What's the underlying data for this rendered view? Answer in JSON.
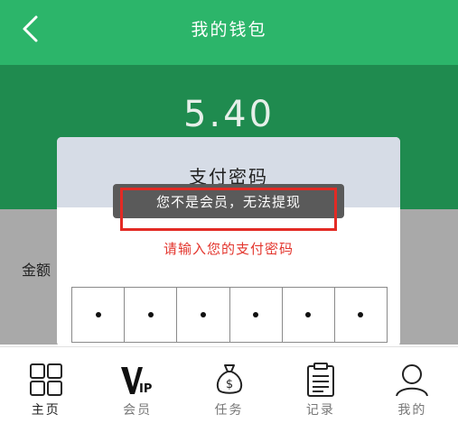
{
  "header": {
    "title": "我的钱包",
    "back_icon": "chevron-left-icon"
  },
  "wallet": {
    "balance": "5.40",
    "amount_label": "金额"
  },
  "dialog": {
    "title": "支付密码",
    "hint": "请输入您的支付密码",
    "pin_length": 6,
    "pin_filled": 6
  },
  "toast": {
    "message": "您不是会员，无法提现"
  },
  "tabbar": {
    "items": [
      {
        "label": "主页",
        "icon": "grid-home-icon",
        "active": true
      },
      {
        "label": "会员",
        "icon": "vip-icon",
        "active": false
      },
      {
        "label": "任务",
        "icon": "money-bag-icon",
        "active": false
      },
      {
        "label": "记录",
        "icon": "clipboard-icon",
        "active": false
      },
      {
        "label": "我的",
        "icon": "user-icon",
        "active": false
      }
    ]
  },
  "colors": {
    "header_bg": "#2cb56a",
    "balance_bg": "#1f8b4f",
    "hint": "#e3352d",
    "highlight_outline": "#e32a24"
  }
}
